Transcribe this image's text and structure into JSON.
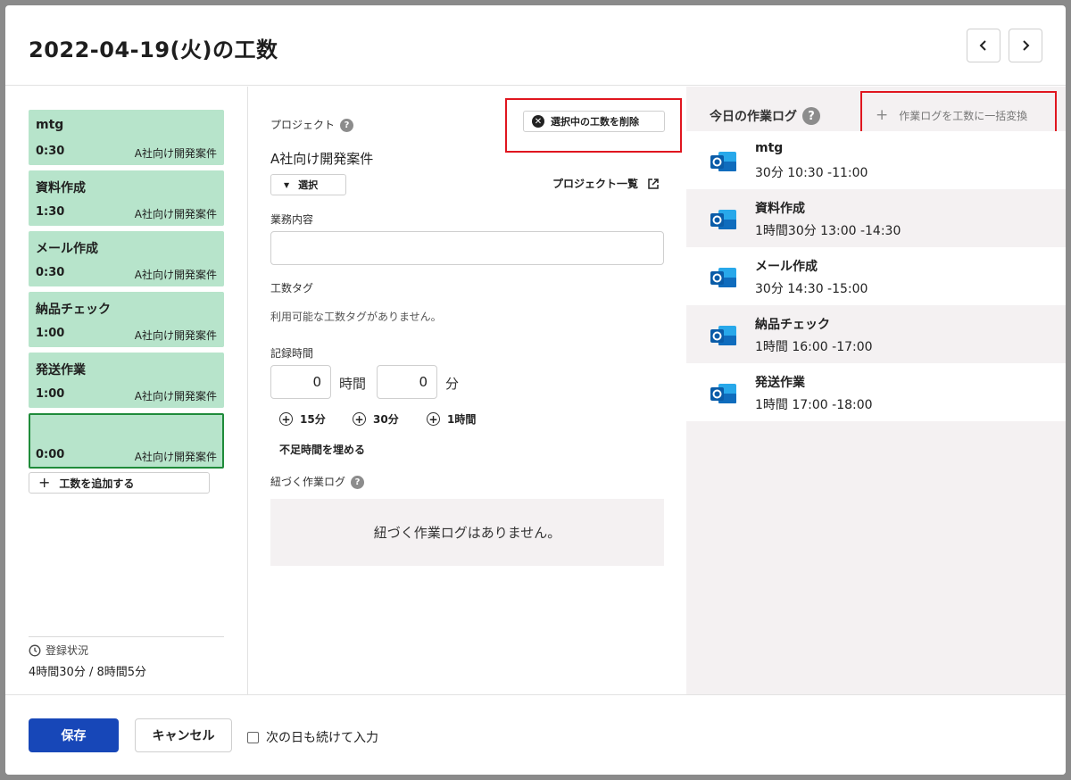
{
  "dialog": {
    "title": "2022-04-19(火)の工数",
    "prev_icon": "chevron-left-icon",
    "next_icon": "chevron-right-icon"
  },
  "entries": [
    {
      "name": "mtg",
      "time": "0:30",
      "project": "A社向け開発案件"
    },
    {
      "name": "資料作成",
      "time": "1:30",
      "project": "A社向け開発案件"
    },
    {
      "name": "メール作成",
      "time": "0:30",
      "project": "A社向け開発案件"
    },
    {
      "name": "納品チェック",
      "time": "1:00",
      "project": "A社向け開発案件"
    },
    {
      "name": "発送作業",
      "time": "1:00",
      "project": "A社向け開発案件"
    },
    {
      "name": "",
      "time": "0:00",
      "project": "A社向け開発案件"
    }
  ],
  "add_entry_label": "工数を追加する",
  "status": {
    "label": "登録状況",
    "value": "4時間30分 / 8時間5分"
  },
  "form": {
    "project_label": "プロジェクト",
    "delete_label": "選択中の工数を削除",
    "project_name": "A社向け開発案件",
    "select_label": "選択",
    "project_list_label": "プロジェクト一覧",
    "task_label": "業務内容",
    "task_value": "",
    "tag_label": "工数タグ",
    "no_tags_text": "利用可能な工数タグがありません。",
    "time_label": "記録時間",
    "hours_value": "0",
    "hours_unit": "時間",
    "minutes_value": "0",
    "minutes_unit": "分",
    "quick_15": "15分",
    "quick_30": "30分",
    "quick_1h": "1時間",
    "fill_shortage": "不足時間を埋める",
    "linked_log_label": "紐づく作業ログ",
    "no_linked_log": "紐づく作業ログはありません。"
  },
  "work_log": {
    "title": "今日の作業ログ",
    "bulk_convert": "作業ログを工数に一括変換",
    "items": [
      {
        "name": "mtg",
        "time": "30分  10:30 -11:00"
      },
      {
        "name": "資料作成",
        "time": "1時間30分  13:00 -14:30"
      },
      {
        "name": "メール作成",
        "time": "30分  14:30 -15:00"
      },
      {
        "name": "納品チェック",
        "time": "1時間  16:00 -17:00"
      },
      {
        "name": "発送作業",
        "time": "1時間  17:00 -18:00"
      }
    ]
  },
  "footer": {
    "save_label": "保存",
    "cancel_label": "キャンセル",
    "continue_label": "次の日も続けて入力",
    "continue_checked": false
  },
  "colors": {
    "entry_bg": "#b7e4cb",
    "selected_border": "#1f8b3a",
    "primary": "#1747b8",
    "highlight_box": "#e0161f",
    "outlook_blue": "#0f6cbd"
  }
}
